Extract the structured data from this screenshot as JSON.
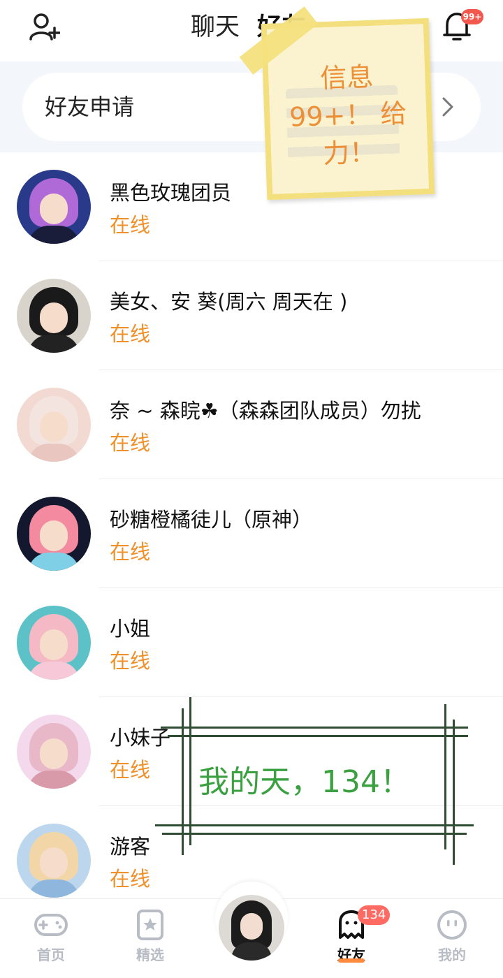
{
  "header": {
    "tab_chat": "聊天",
    "tab_friends": "好友",
    "notification_badge": "99+",
    "icons": {
      "add_friend": "person-add-icon",
      "notifications": "bell-icon"
    }
  },
  "friend_request": {
    "label": "好友申请",
    "icon": "chevron-right-icon"
  },
  "friends": [
    {
      "name": "黑色玫瑰团员",
      "status": "在线"
    },
    {
      "name": "美女、安 葵(周六 周天在 )",
      "status": "在线"
    },
    {
      "name": "奈 ~ 森睆☘（森森团队成员）勿扰",
      "status": "在线"
    },
    {
      "name": "砂糖橙橘徒儿（原神）",
      "status": "在线"
    },
    {
      "name": "小姐",
      "status": "在线"
    },
    {
      "name": "小妹子",
      "status": "在线"
    },
    {
      "name": "游客",
      "status": "在线"
    }
  ],
  "overlays": {
    "sticky_note": "信息\n99+！ 给\n力！",
    "framed_text": "我的天，134！"
  },
  "tabbar": {
    "items": [
      {
        "label": "首页",
        "icon": "gamepad-icon"
      },
      {
        "label": "精选",
        "icon": "star-card-icon"
      },
      {
        "label": "好友",
        "icon": "ghost-icon",
        "badge": "134",
        "active": true
      },
      {
        "label": "我的",
        "icon": "smiley-icon"
      }
    ]
  },
  "colors": {
    "accent": "#f0902a",
    "badge": "#ff6b63",
    "sticky_border": "#f3df7d",
    "frame_text": "#3aa040"
  }
}
